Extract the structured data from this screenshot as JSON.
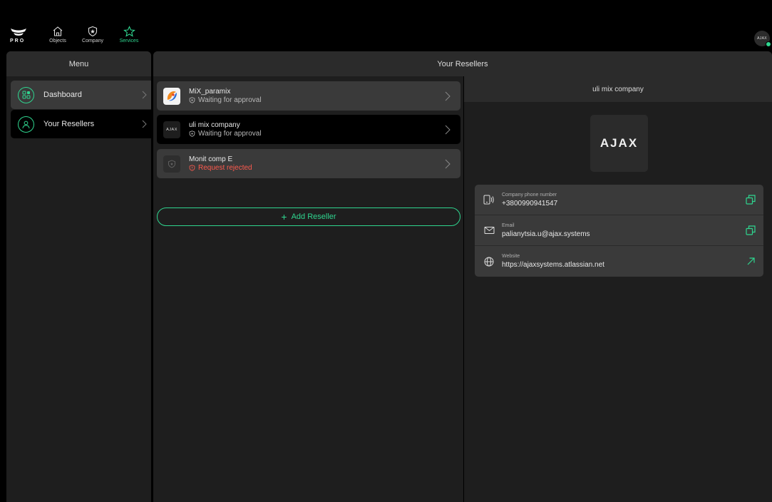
{
  "app": {
    "logo_text": "PRO",
    "accent": "#2fd58f",
    "danger": "#ff5a4e"
  },
  "nav": [
    {
      "label": "Objects",
      "icon": "home-icon"
    },
    {
      "label": "Company",
      "icon": "shield-star-icon"
    },
    {
      "label": "Services",
      "icon": "star-icon",
      "active": true
    }
  ],
  "avatar": {
    "text": "AJAX"
  },
  "menu": {
    "title": "Menu",
    "items": [
      {
        "label": "Dashboard",
        "icon": "dashboard-icon"
      },
      {
        "label": "Your Resellers",
        "icon": "reseller-user-icon"
      }
    ]
  },
  "main": {
    "title": "Your Resellers",
    "resellers": [
      {
        "name": "MiX_paramix",
        "status": "Waiting for approval",
        "logo": "mix-logo"
      },
      {
        "name": "uli mix company",
        "status": "Waiting for approval",
        "logo": "ajax-logo",
        "logo_text": "AJAX"
      },
      {
        "name": "Monit comp E",
        "status": "Request rejected",
        "logo": "placeholder-shield-logo"
      }
    ],
    "add_label": "Add Reseller"
  },
  "detail": {
    "title": "uli mix company",
    "logo_text": "AJAX",
    "rows": [
      {
        "label": "Company phone number",
        "value": "+3800990941547",
        "icon": "phone-icon",
        "action": "copy-icon"
      },
      {
        "label": "Email",
        "value": "palianytsia.u@ajax.systems",
        "icon": "mail-icon",
        "action": "copy-icon"
      },
      {
        "label": "Website",
        "value": "https://ajaxsystems.atlassian.net",
        "icon": "globe-icon",
        "action": "external-link-icon"
      }
    ]
  }
}
